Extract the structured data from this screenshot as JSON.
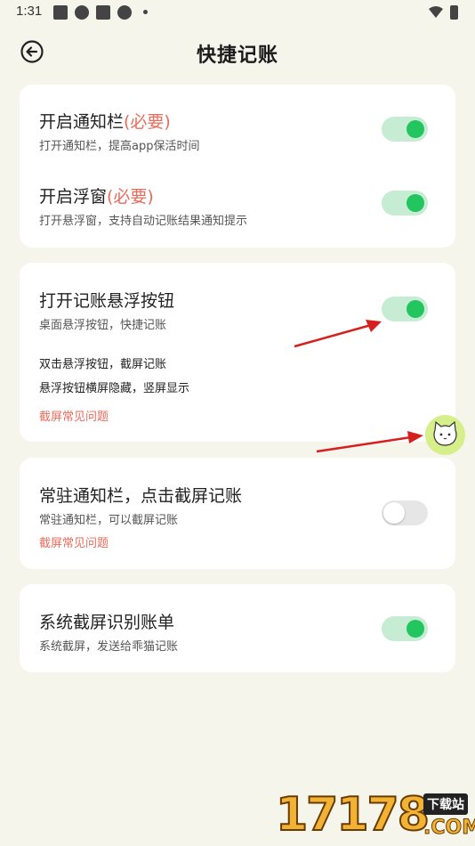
{
  "status_bar": {
    "time": "1:31"
  },
  "header": {
    "title": "快捷记账"
  },
  "card1": {
    "row1": {
      "title": "开启通知栏",
      "required": "(必要)",
      "subtitle": "打开通知栏，提高app保活时间",
      "toggle": "on"
    },
    "row2": {
      "title": "开启浮窗",
      "required": "(必要)",
      "subtitle": "打开悬浮窗，支持自动记账结果通知提示",
      "toggle": "on"
    }
  },
  "card2": {
    "title": "打开记账悬浮按钮",
    "subtitle": "桌面悬浮按钮，快捷记账",
    "line1": "双击悬浮按钮，截屏记账",
    "line2": "悬浮按钮横屏隐藏，竖屏显示",
    "link": "截屏常见问题",
    "toggle": "on"
  },
  "card3": {
    "title": "常驻通知栏，点击截屏记账",
    "subtitle": "常驻通知栏，可以截屏记账",
    "link": "截屏常见问题",
    "toggle": "off"
  },
  "card4": {
    "title": "系统截屏识别账单",
    "subtitle": "系统截屏，发送给乖猫记账",
    "toggle": "on"
  },
  "watermark": {
    "number": "17178",
    "badge": "下载站",
    "domain": ".COM"
  },
  "colors": {
    "accent_green": "#22c55e",
    "required_red": "#ec6b5b",
    "background": "#f5f5ec"
  }
}
